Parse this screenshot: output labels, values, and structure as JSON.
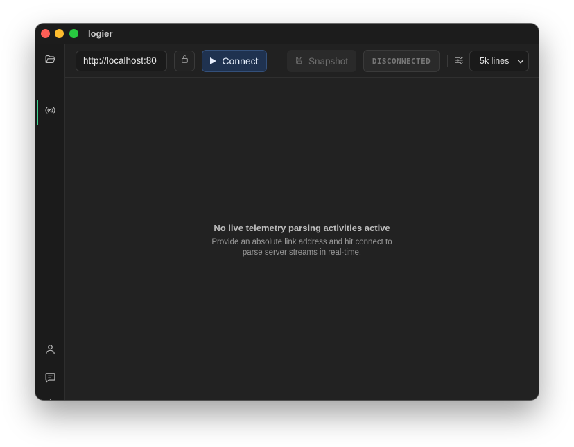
{
  "window": {
    "title": "logier",
    "controls": [
      "close",
      "minimize",
      "maximize"
    ]
  },
  "sidebar": {
    "top_items": [
      {
        "icon": "folder-open-icon",
        "active": false
      },
      {
        "icon": "broadcast-icon",
        "active": true
      }
    ],
    "bottom_items": [
      {
        "icon": "user-icon"
      },
      {
        "icon": "chat-icon"
      },
      {
        "icon": "gear-icon"
      }
    ],
    "accent_color": "#3ecf8e"
  },
  "toolbar": {
    "url_value": "http://localhost:80",
    "lock_icon": "lock-icon",
    "connect_label": "Connect",
    "snapshot_label": "Snapshot",
    "status_text": "DISCONNECTED",
    "filter_icon": "sliders-icon",
    "lines_selected": "5k lines"
  },
  "main": {
    "empty_title": "No live telemetry parsing activities active",
    "empty_description": "Provide an absolute link address and hit connect to parse server streams in real-time."
  }
}
